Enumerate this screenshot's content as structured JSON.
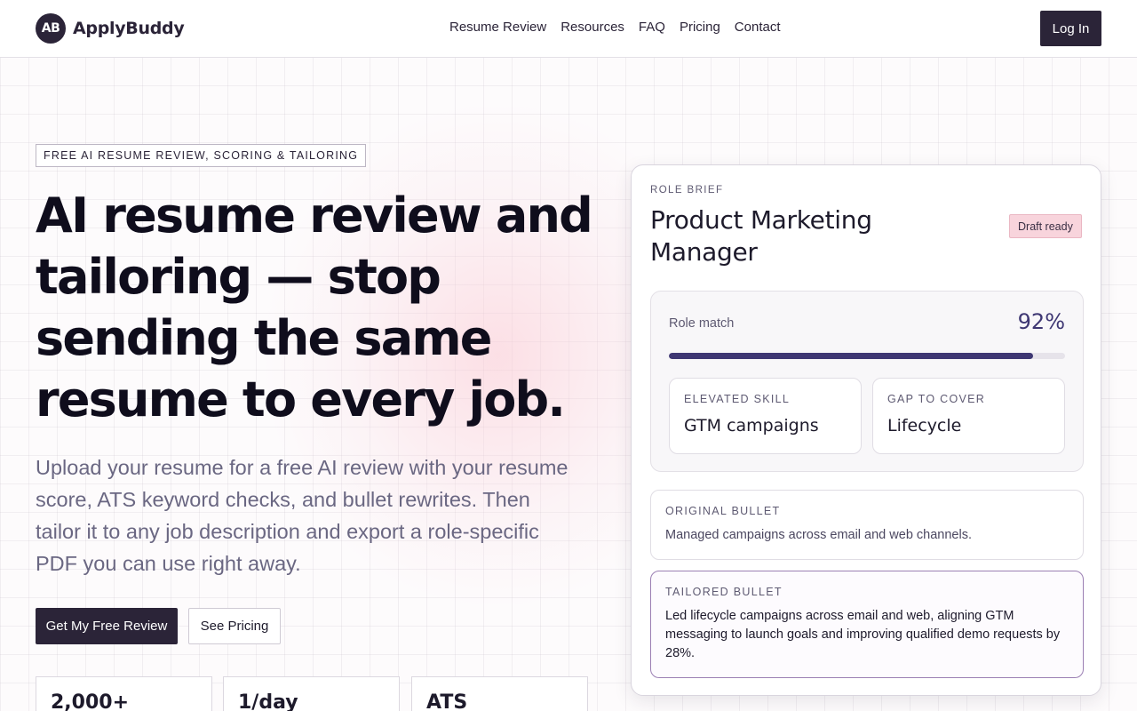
{
  "header": {
    "logo_mark": "AB",
    "logo_text": "ApplyBuddy",
    "nav": [
      "Resume Review",
      "Resources",
      "FAQ",
      "Pricing",
      "Contact"
    ],
    "login_label": "Log In"
  },
  "hero": {
    "eyebrow": "FREE AI RESUME REVIEW, SCORING & TAILORING",
    "title": "AI resume review and tailoring — stop sending the same resume to every job.",
    "subtitle": "Upload your resume for a free AI review with your resume score, ATS keyword checks, and bullet rewrites. Then tailor it to any job description and export a role-specific PDF you can use right away.",
    "primary_cta": "Get My Free Review",
    "secondary_cta": "See Pricing",
    "stats": [
      "2,000+",
      "1/day",
      "ATS"
    ]
  },
  "card": {
    "label": "ROLE BRIEF",
    "title": "Product Marketing Manager",
    "badge": "Draft ready",
    "match_label": "Role match",
    "match_value": "92%",
    "match_fraction": 0.92,
    "skill_label": "ELEVATED SKILL",
    "skill_value": "GTM campaigns",
    "gap_label": "GAP TO COVER",
    "gap_value": "Lifecycle",
    "original_label": "ORIGINAL BULLET",
    "original_text": "Managed campaigns across email and web channels.",
    "tailored_label": "TAILORED BULLET",
    "tailored_text": "Led lifecycle campaigns across email and web, aligning GTM messaging to launch goals and improving qualified demo requests by 28%."
  }
}
